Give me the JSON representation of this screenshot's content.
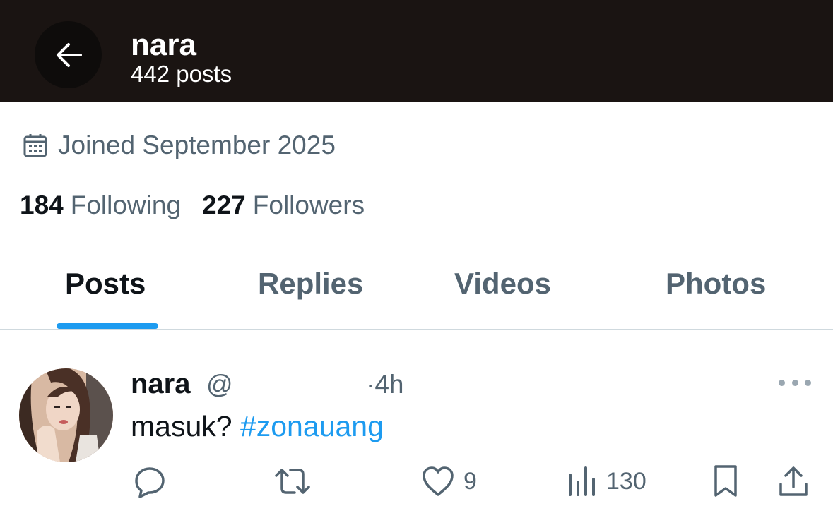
{
  "header": {
    "name": "nara",
    "post_count": "442 posts"
  },
  "profile": {
    "joined": "Joined September 2025",
    "following_count": "184",
    "following_label": "Following",
    "followers_count": "227",
    "followers_label": "Followers"
  },
  "tabs": [
    {
      "label": "Posts",
      "active": true
    },
    {
      "label": "Replies",
      "active": false
    },
    {
      "label": "Videos",
      "active": false
    },
    {
      "label": "Photos",
      "active": false
    }
  ],
  "post": {
    "name": "nara",
    "handle": "@",
    "time": "·4h",
    "text": "masuk? ",
    "hashtag": "#zonauang",
    "likes": "9",
    "views": "130"
  },
  "colors": {
    "accent": "#1d9bf0",
    "header_bg": "#1a1412",
    "muted_text": "#536471",
    "primary_text": "#0f1419"
  },
  "icons": [
    "back-arrow-icon",
    "calendar-icon",
    "more-icon",
    "reply-icon",
    "repost-icon",
    "like-icon",
    "views-icon",
    "bookmark-icon",
    "share-icon"
  ]
}
